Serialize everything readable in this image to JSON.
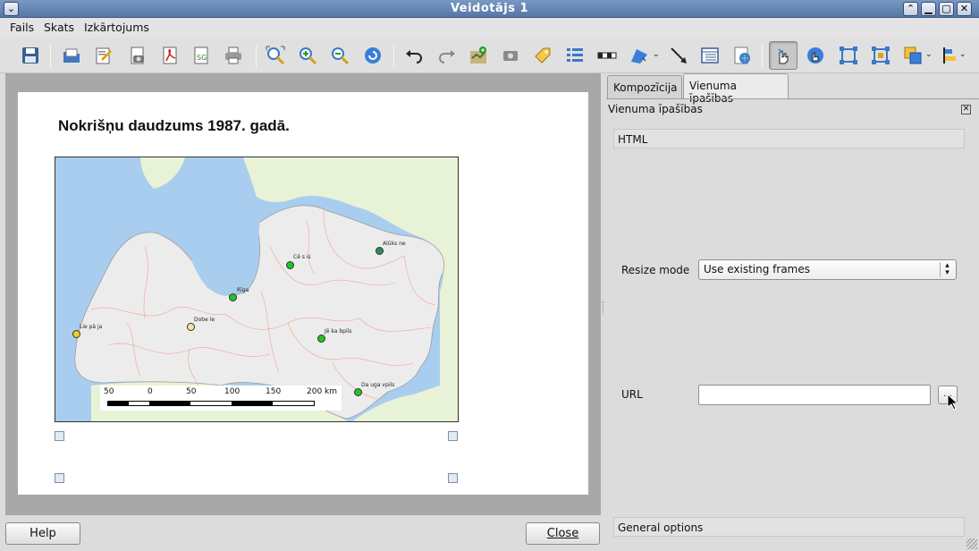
{
  "window": {
    "title": "Veidotājs 1",
    "menu_icon": "chevron-down-icon",
    "controls": [
      "chevron-up-icon",
      "minimize-icon",
      "maximize-icon",
      "close-icon"
    ]
  },
  "menu": [
    "Fails",
    "Skats",
    "Izkārtojums"
  ],
  "toolbar": {
    "tools": [
      "save-icon",
      "open-template-icon",
      "save-template-icon",
      "export-image-icon",
      "export-pdf-icon",
      "export-svg-icon",
      "print-icon",
      "zoom-full-icon",
      "zoom-in-icon",
      "zoom-out-icon",
      "refresh-icon",
      "undo-icon",
      "redo-icon",
      "add-map-icon",
      "add-image-icon",
      "add-label-icon",
      "add-legend-icon",
      "add-scalebar-icon",
      "add-shape-icon",
      "add-arrow-icon",
      "add-table-icon",
      "add-html-icon",
      "select-move-icon",
      "move-content-icon",
      "group-icon",
      "ungroup-icon",
      "raise-items-icon",
      "align-items-icon"
    ],
    "active_tool": "select-move-icon"
  },
  "composition": {
    "title": "Nokrišņu daudzums 1987. gadā.",
    "map": {
      "land_color": "#ececec",
      "water_color": "#a9cdee",
      "neighbor_color": "#e8f2d6",
      "border_color": "#f29a88",
      "cities": [
        {
          "name": "Alūks ne",
          "color": "#2e8b57"
        },
        {
          "name": "Cē s is",
          "color": "#22c422"
        },
        {
          "name": "Rīga",
          "color": "#22c422"
        },
        {
          "name": "Dobe le",
          "color": "#f4e3a1"
        },
        {
          "name": "Lie pā ja",
          "color": "#f0d020"
        },
        {
          "name": "Jē ka bpils",
          "color": "#22c422"
        },
        {
          "name": "Da uga vpils",
          "color": "#22c422"
        }
      ],
      "scalebar": {
        "ticks": [
          "50",
          "0",
          "50",
          "100",
          "150",
          "200 km"
        ]
      }
    }
  },
  "panel": {
    "tabs": [
      "Kompozīcija",
      "Vienuma īpašības"
    ],
    "selected_tab": "Vienuma īpašības",
    "header": "Vienuma īpašības",
    "close_icon": "close-icon",
    "section_html": "HTML",
    "resize_mode_label": "Resize mode",
    "resize_mode_value": "Use existing frames",
    "url_label": "URL",
    "url_value": "",
    "browse_label": "...",
    "section_general": "General options"
  },
  "buttons": {
    "help": "Help",
    "close": "Close"
  }
}
